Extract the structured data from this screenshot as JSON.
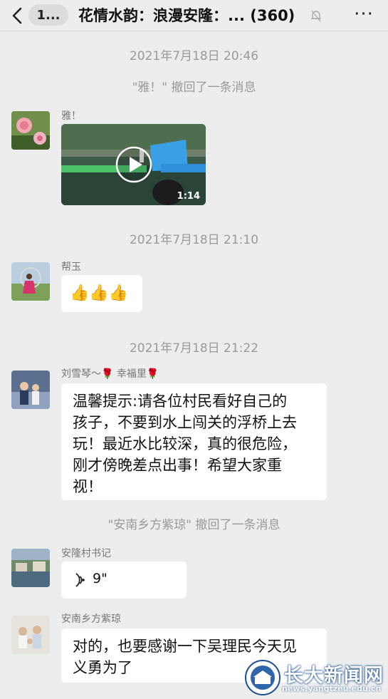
{
  "header": {
    "unread_label": "1...",
    "title": "花情水韵：浪漫安隆：... (360)",
    "more_label": "···"
  },
  "timestamps": [
    "2021年7月18日 20:46",
    "2021年7月18日 21:10",
    "2021年7月18日 21:22"
  ],
  "system_notices": [
    "\"雅！\" 撤回了一条消息",
    "\"安南乡方紫琼\" 撤回了一条消息"
  ],
  "messages": [
    {
      "sender": "雅！",
      "type": "video",
      "duration": "1:14"
    },
    {
      "sender": "帮玉",
      "type": "emoji",
      "content": "👍👍👍"
    },
    {
      "sender": "刘雪琴～🌹 幸福里🌹",
      "type": "text",
      "lines": [
        "温馨提示:请各位村民看好自己的",
        "孩子，不要到水上闯关的浮桥上去",
        "玩！最近水比较深，真的很危险，",
        "刚才傍晚差点出事！希望大家重",
        "视！"
      ]
    },
    {
      "sender": "安隆村书记",
      "type": "voice",
      "duration": "9\""
    },
    {
      "sender": "安南乡方紫琼",
      "type": "text",
      "lines": [
        "对的，也要感谢一下吴理民今天见",
        "义勇为了"
      ]
    }
  ],
  "watermark": {
    "title": "长大新闻网",
    "url": "news.yangtzeu.edu.cn"
  },
  "colors": {
    "background": "#ededed",
    "bubble": "#ffffff",
    "system_text": "#9a9a9a"
  }
}
